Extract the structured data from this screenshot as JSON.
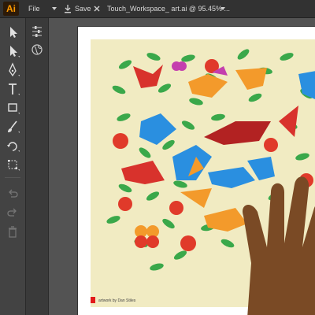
{
  "app": {
    "logo": "Ai",
    "menu_file": "File",
    "save_label": "Save",
    "document_tab": "Touch_Workspace_ art.ai @ 95.45% ..."
  },
  "artwork": {
    "credit": "artwork by Dan Stiles"
  },
  "icons": {
    "dropdown": "chevron-down-icon",
    "save": "save-icon",
    "close": "close-icon"
  },
  "colors": {
    "topbar": "#323232",
    "toolbar": "#434343",
    "canvas": "#535353",
    "artwork_bg": "#f1ebc2",
    "leaf_green": "#3aa84a",
    "bird_red": "#d8322c",
    "bird_blue": "#2a8fe0",
    "bird_orange": "#f39a2b",
    "hand_brown": "#7a4a25"
  }
}
